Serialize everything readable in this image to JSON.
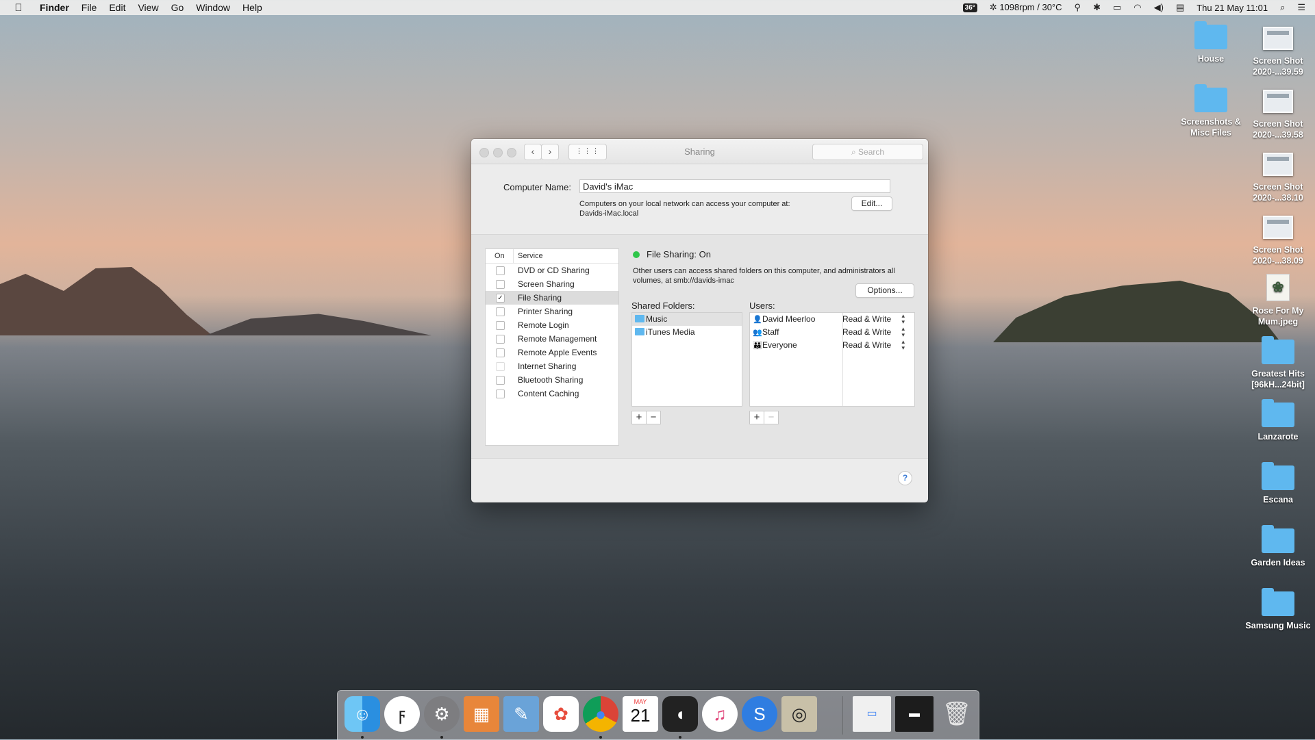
{
  "menubar": {
    "apple": "",
    "app": "Finder",
    "items": [
      "File",
      "Edit",
      "View",
      "Go",
      "Window",
      "Help"
    ],
    "temp_badge": "36°",
    "fan": "1098rpm / 30°C",
    "datetime": "Thu 21 May  11:01"
  },
  "desktop": {
    "icons": [
      {
        "label": "House",
        "type": "folder"
      },
      {
        "label": "Screen Shot 2020-...39.59",
        "type": "screenshot"
      },
      {
        "label": "Screenshots & Misc Files",
        "type": "folder"
      },
      {
        "label": "Screen Shot 2020-...39.58",
        "type": "screenshot"
      },
      {
        "label": "Screen Shot 2020-...38.10",
        "type": "screenshot"
      },
      {
        "label": "Screen Shot 2020-...38.09",
        "type": "screenshot"
      },
      {
        "label": "Rose For My Mum.jpeg",
        "type": "image"
      },
      {
        "label": "Greatest Hits [96kH...24bit]",
        "type": "folder"
      },
      {
        "label": "Lanzarote",
        "type": "folder"
      },
      {
        "label": "Escana",
        "type": "folder"
      },
      {
        "label": "Garden Ideas",
        "type": "folder"
      },
      {
        "label": "Samsung Music",
        "type": "folder"
      }
    ]
  },
  "window": {
    "title": "Sharing",
    "search_placeholder": "Search",
    "computer_name_label": "Computer Name:",
    "computer_name_value": "David's iMac",
    "network_note_1": "Computers on your local network can access your computer at:",
    "network_note_2": "Davids-iMac.local",
    "edit_button": "Edit...",
    "services_header_on": "On",
    "services_header_service": "Service",
    "services": [
      {
        "label": "DVD or CD Sharing",
        "checked": false
      },
      {
        "label": "Screen Sharing",
        "checked": false
      },
      {
        "label": "File Sharing",
        "checked": true
      },
      {
        "label": "Printer Sharing",
        "checked": false
      },
      {
        "label": "Remote Login",
        "checked": false
      },
      {
        "label": "Remote Management",
        "checked": false
      },
      {
        "label": "Remote Apple Events",
        "checked": false
      },
      {
        "label": "Internet Sharing",
        "checked": false
      },
      {
        "label": "Bluetooth Sharing",
        "checked": false
      },
      {
        "label": "Content Caching",
        "checked": false
      }
    ],
    "status_title": "File Sharing: On",
    "status_color": "#2fc64a",
    "status_desc": "Other users can access shared folders on this computer, and administrators all volumes, at smb://davids-imac",
    "options_button": "Options...",
    "shared_folders_label": "Shared Folders:",
    "shared_folders": [
      "Music",
      "iTunes Media"
    ],
    "users_label": "Users:",
    "users": [
      {
        "name": "David Meerloo",
        "permission": "Read & Write",
        "icon": "single-user-icon"
      },
      {
        "name": "Staff",
        "permission": "Read & Write",
        "icon": "group-icon"
      },
      {
        "name": "Everyone",
        "permission": "Read & Write",
        "icon": "everyone-icon"
      }
    ],
    "plus": "+",
    "minus": "−",
    "help": "?"
  },
  "dock": {
    "apps": [
      "Finder",
      "Fing",
      "System Preferences",
      "Calculator",
      "Preview",
      "Photos",
      "Chrome",
      "Calendar",
      "Podcast Player",
      "iTunes",
      "Shazam",
      "Audio",
      "Chrome Screenshot",
      "Screen",
      "Trash"
    ],
    "calendar_month": "MAY",
    "calendar_day": "21"
  }
}
